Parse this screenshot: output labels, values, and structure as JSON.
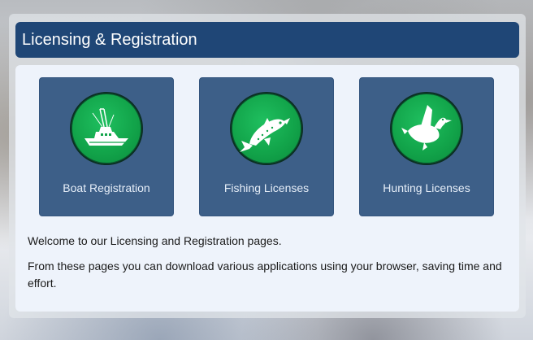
{
  "header": {
    "title": "Licensing & Registration"
  },
  "tiles": [
    {
      "label": "Boat Registration",
      "icon": "boat-icon"
    },
    {
      "label": "Fishing Licenses",
      "icon": "fish-icon"
    },
    {
      "label": "Hunting Licenses",
      "icon": "duck-icon"
    }
  ],
  "intro": {
    "line1": "Welcome to our Licensing and Registration pages.",
    "line2": "From these pages you can download various applications using your browser, saving time and effort."
  },
  "colors": {
    "header_bg": "#1f4676",
    "tile_bg": "#3d5f88",
    "icon_circle": "#12a44a",
    "content_bg": "#eef3fb"
  }
}
